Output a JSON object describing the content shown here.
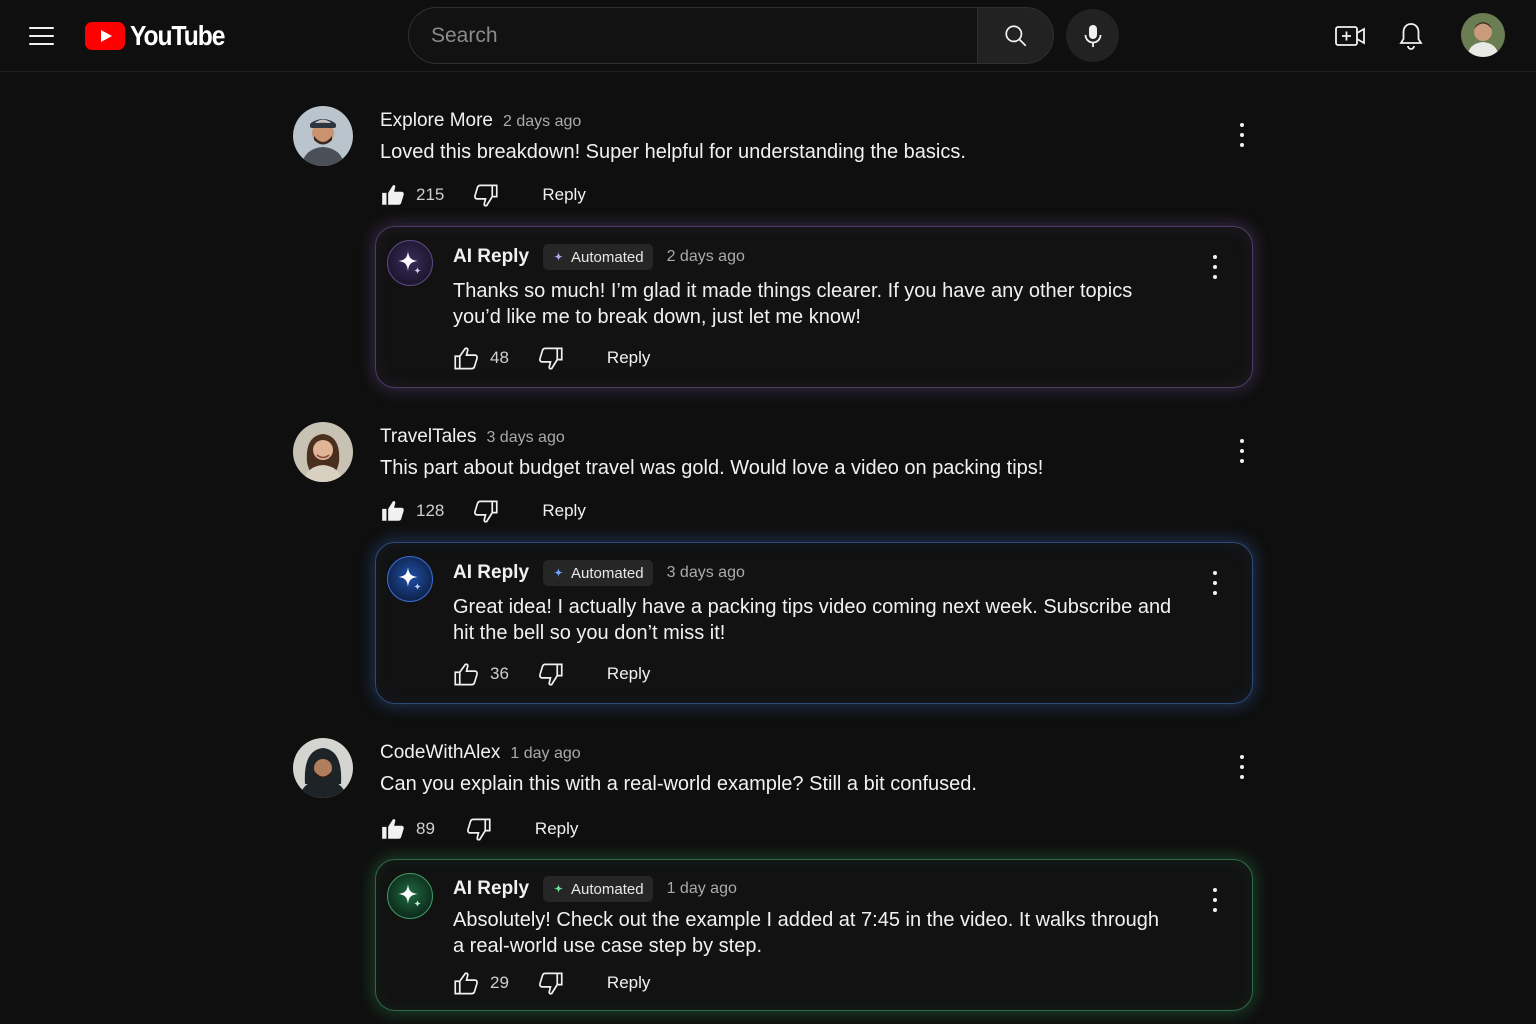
{
  "header": {
    "logo_text": "YouTube",
    "search_placeholder": "Search"
  },
  "colors": {
    "background": "#0f0f0f",
    "brand_red": "#ff0000",
    "ai_purple": "#9a6ed2",
    "ai_blue": "#3c78dc",
    "ai_green": "#3cbe6e"
  },
  "icons": [
    "hamburger-menu-icon",
    "youtube-logo-icon",
    "search-icon",
    "microphone-icon",
    "create-video-icon",
    "bell-icon",
    "thumbs-up-icon",
    "thumbs-down-icon",
    "sparkle-icon",
    "more-vert-icon"
  ],
  "comments": [
    {
      "author": "Explore More",
      "time": "2 days ago",
      "text": "Loved this breakdown! Super helpful for understanding the basics.",
      "likes": "215",
      "reply_label": "Reply",
      "ai_reply": {
        "name": "AI Reply",
        "badge": "Automated",
        "time": "2 days ago",
        "text": "Thanks so much! I’m glad it made things clearer. If you have any other topics you’d like me to break down, just let me know!",
        "likes": "48",
        "reply_label": "Reply"
      }
    },
    {
      "author": "TravelTales",
      "time": "3 days ago",
      "text": "This part about budget travel was gold. Would love a video on packing tips!",
      "likes": "128",
      "reply_label": "Reply",
      "ai_reply": {
        "name": "AI Reply",
        "badge": "Automated",
        "time": "3 days ago",
        "text": "Great idea! I actually have a packing tips video coming next week. Subscribe and hit the bell so you don’t miss it!",
        "likes": "36",
        "reply_label": "Reply"
      }
    },
    {
      "author": "CodeWithAlex",
      "time": "1 day ago",
      "text": "Can you explain this with a real-world example? Still a bit confused.",
      "likes": "89",
      "reply_label": "Reply",
      "ai_reply": {
        "name": "AI Reply",
        "badge": "Automated",
        "time": "1 day ago",
        "text": "Absolutely! Check out the example I added at 7:45 in the video. It walks through a real-world use case step by step.",
        "likes": "29",
        "reply_label": "Reply"
      }
    }
  ]
}
